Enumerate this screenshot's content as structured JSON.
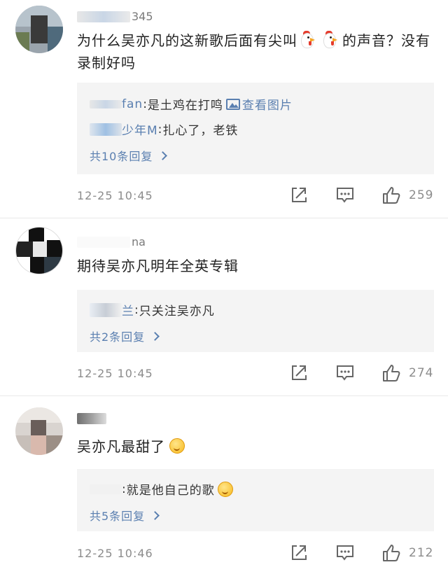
{
  "comments": [
    {
      "username_suffix": "345",
      "text_part1": "为什么吴亦凡的这新歌后面有尖叫",
      "text_part2": "的声音？没有录制好吗",
      "emoji_icons": [
        "rooster-emoji",
        "rooster-emoji"
      ],
      "replies": [
        {
          "name": "fan",
          "sep": ": ",
          "text": "是土鸡在打鸣",
          "image_link": "查看图片"
        },
        {
          "name": "少年M",
          "sep": ": ",
          "text": "扎心了，老铁"
        }
      ],
      "more_replies": "共10条回复",
      "time": "12-25 10:45",
      "likes": "259"
    },
    {
      "username_suffix": "na",
      "text": "期待吴亦凡明年全英专辑",
      "replies": [
        {
          "name": "兰",
          "sep": ": ",
          "text": "只关注吴亦凡"
        }
      ],
      "more_replies": "共2条回复",
      "time": "12-25 10:45",
      "likes": "274"
    },
    {
      "username_suffix": "",
      "text": "吴亦凡最甜了",
      "emoji_icons": [
        "smile-emoji"
      ],
      "replies": [
        {
          "name": "",
          "sep": ": ",
          "text": "就是他自己的歌",
          "emoji": "drooling-emoji"
        }
      ],
      "more_replies": "共5条回复",
      "time": "12-25 10:46",
      "likes": "212"
    }
  ],
  "icons": {
    "share": "share-icon",
    "comment": "comment-icon",
    "like": "thumbs-up-icon"
  },
  "colors": {
    "link": "#5a7fb0",
    "reply_bg": "#f4f4f4",
    "meta": "#8c8c8c",
    "text": "#222222"
  }
}
